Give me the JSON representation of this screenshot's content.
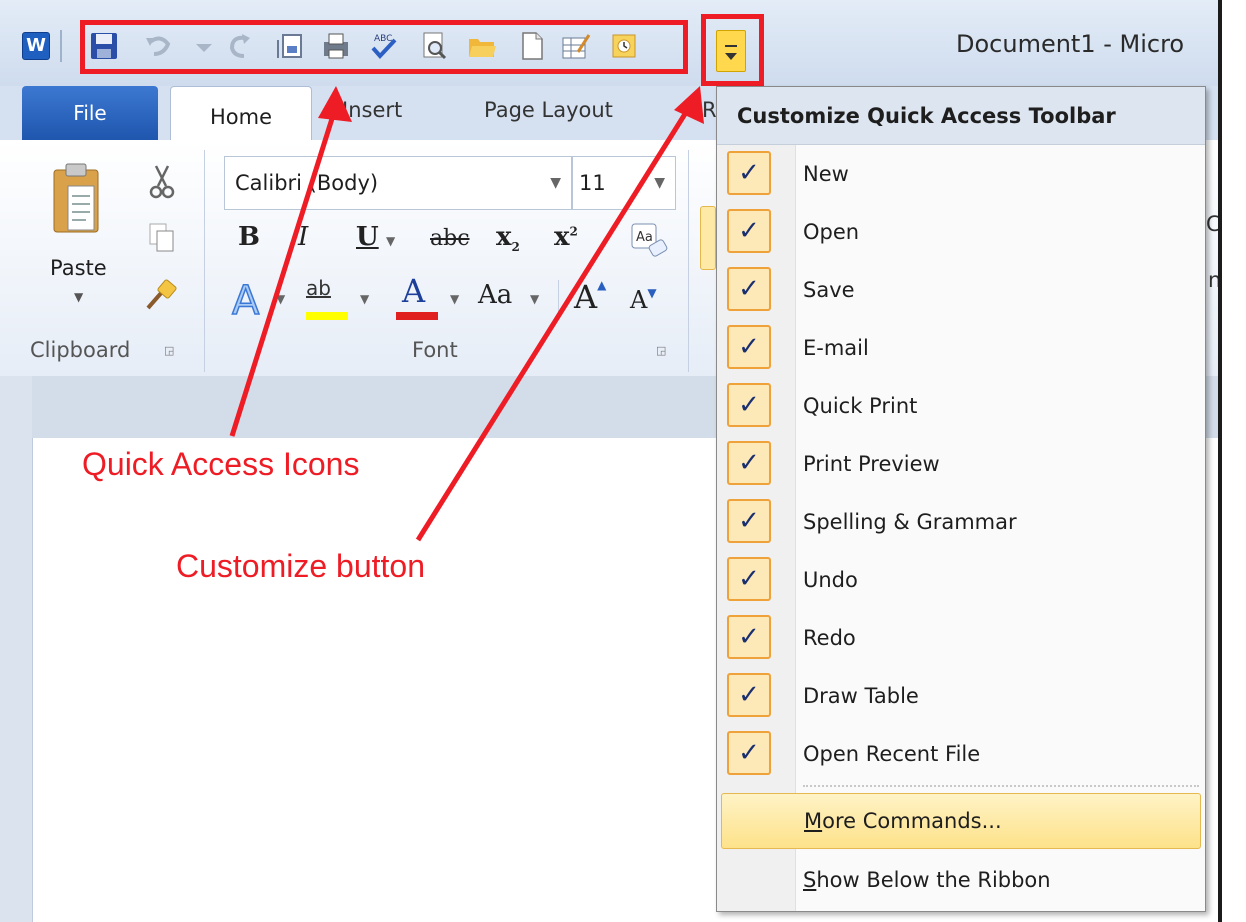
{
  "window": {
    "title": "Document1 - Micro",
    "app_logo": "W"
  },
  "qat_icons": [
    "save-icon",
    "undo-icon",
    "redo-icon",
    "email-icon",
    "quick-print-icon",
    "spelling-grammar-icon",
    "print-preview-icon",
    "open-icon",
    "new-icon",
    "draw-table-icon",
    "open-recent-file-icon"
  ],
  "tabs": {
    "file": "File",
    "home": "Home",
    "insert": "Insert",
    "page_layout": "Page Layout",
    "partial": "R"
  },
  "ribbon": {
    "clipboard": {
      "paste": "Paste",
      "label": "Clipboard"
    },
    "font": {
      "name": "Calibri (Body)",
      "size": "11",
      "bold": "B",
      "italic": "I",
      "underline": "U",
      "strike": "abc",
      "subscript": "x",
      "superscript": "x",
      "highlight": "ab",
      "font_color": "A",
      "change_case": "Aa",
      "grow": "A",
      "shrink": "A",
      "label": "Font"
    },
    "partial_right_1": "C",
    "partial_right_2": "n"
  },
  "annotations": {
    "quick_access": "Quick Access Icons",
    "customize": "Customize button"
  },
  "menu": {
    "header": "Customize Quick Access Toolbar",
    "checked_items": [
      "New",
      "Open",
      "Save",
      "E-mail",
      "Quick Print",
      "Print Preview",
      "Spelling & Grammar",
      "Undo",
      "Redo",
      "Draw Table",
      "Open Recent File"
    ],
    "check_glyph": "✓",
    "more_commands": {
      "accel": "M",
      "rest": "ore Commands..."
    },
    "show_below": {
      "accel": "S",
      "rest": "how Below the Ribbon"
    }
  },
  "colors": {
    "annotation_red": "#ee1c25",
    "check_bg": "#fde9b8",
    "check_border": "#f0a23a",
    "file_tab": "#2b63bd"
  }
}
